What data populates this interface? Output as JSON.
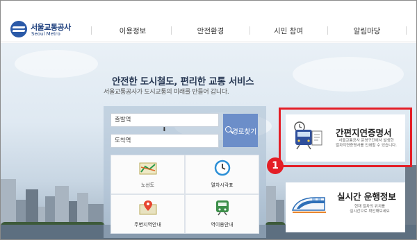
{
  "header": {
    "logo_ko": "서울교통공사",
    "logo_en": "Seoul Metro",
    "nav": [
      "이용정보",
      "안전환경",
      "시민 참여",
      "알림마당"
    ]
  },
  "hero": {
    "title": "안전한 도시철도, 편리한 교통 서비스",
    "subtitle": "서울교통공사가 도시교통의 미래를 만들어 갑니다."
  },
  "route_search": {
    "departure_placeholder": "출발역",
    "arrival_placeholder": "도착역",
    "swap_symbol": "⬇",
    "search_button": "경로찾기"
  },
  "quick_menu": [
    {
      "label": "노선도",
      "icon": "route-map-icon"
    },
    {
      "label": "열차시각표",
      "icon": "clock-icon"
    },
    {
      "label": "주변지역안내",
      "icon": "map-pin-icon"
    },
    {
      "label": "역이용안내",
      "icon": "train-icon"
    }
  ],
  "cards": [
    {
      "title": "간편지연증명서",
      "desc_line1": "서울교통공사 운영구간에서 발생한",
      "desc_line2": "열차지연증명서를 인쇄할 수 있습니다.",
      "icon": "delay-certificate-icon"
    },
    {
      "title": "실시간 운행정보",
      "desc_line1": "현재 열차의 위치를",
      "desc_line2": "실시간으로 확인해보세요",
      "icon": "high-speed-train-icon"
    }
  ],
  "annotation": {
    "badge": "1"
  },
  "colors": {
    "brand_blue": "#2b5aa8",
    "accent_red": "#e41e26",
    "search_button": "#6c8ec9"
  }
}
